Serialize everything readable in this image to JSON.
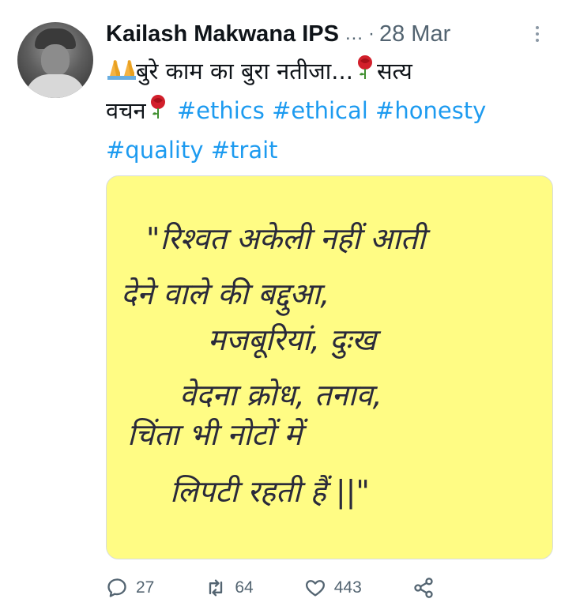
{
  "tweet": {
    "author": "Kailash Makwana IPS",
    "ellipsis": "...",
    "separator": "·",
    "date": "28 Mar",
    "text": {
      "part1": "बुरे काम का बुरा नतीजा...",
      "part2": "सत्य",
      "part3": "वचन",
      "hashtags": [
        "#ethics",
        "#ethical",
        "#honesty",
        "#quality",
        "#trait"
      ]
    },
    "image_text": [
      "\"रिश्वत अकेली नहीं आती",
      "देने वाले की बद्दुआ,",
      "मजबूरियां, दुःख",
      "वेदना क्रोध, तनाव,",
      "चिंता भी नोटों में",
      "लिपटी रहती हैं ||\""
    ],
    "stats": {
      "replies": "27",
      "retweets": "64",
      "likes": "443"
    }
  },
  "colors": {
    "hashtag": "#1d9bf0",
    "note_bg": "#fffc84",
    "muted": "#536471"
  },
  "icons": [
    "folded-hands-icon",
    "rose-icon",
    "reply-icon",
    "retweet-icon",
    "like-icon",
    "share-icon",
    "more-icon"
  ]
}
